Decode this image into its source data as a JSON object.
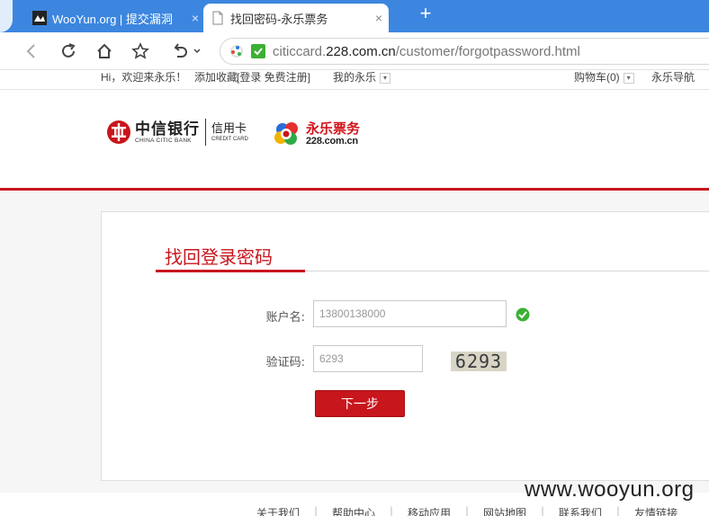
{
  "browser": {
    "tabs": [
      {
        "title": "WooYun.org | 提交漏洞",
        "close": "×",
        "active": false
      },
      {
        "title": "找回密码-永乐票务",
        "close": "×",
        "active": true
      }
    ],
    "new_tab": "+",
    "address": {
      "prefix": "citiccard.",
      "domain": "228.com.cn",
      "path": "/customer/forgotpassword.html"
    }
  },
  "site": {
    "topstrip": {
      "welcome": "Hi，欢迎来永乐！",
      "favorite": "添加收藏",
      "auth": "[登录 免费注册]",
      "my_yongle": "我的永乐",
      "cart": "购物车(0)",
      "guide": "永乐导航"
    },
    "brand": {
      "citic_cn": "中信银行",
      "citic_en": "CHINA CITIC BANK",
      "credit_cn": "信用卡",
      "credit_en": "CREDIT CARD",
      "yongle_cn": "永乐票务",
      "yongle_en": "228.com.cn"
    }
  },
  "form": {
    "title": "找回登录密码",
    "account_label": "账户名:",
    "account_value": "13800138000",
    "captcha_label": "验证码:",
    "captcha_value": "6293",
    "captcha_image_text": "6293",
    "submit_label": "下一步"
  },
  "footer": {
    "links": [
      "关于我们",
      "帮助中心",
      "移动应用",
      "网站地图",
      "联系我们",
      "友情链接"
    ],
    "separator": "|"
  },
  "watermark": "www.wooyun.org",
  "colors": {
    "accent": "#c8161d",
    "tabbar": "#3c86e0",
    "success": "#3cb034"
  }
}
